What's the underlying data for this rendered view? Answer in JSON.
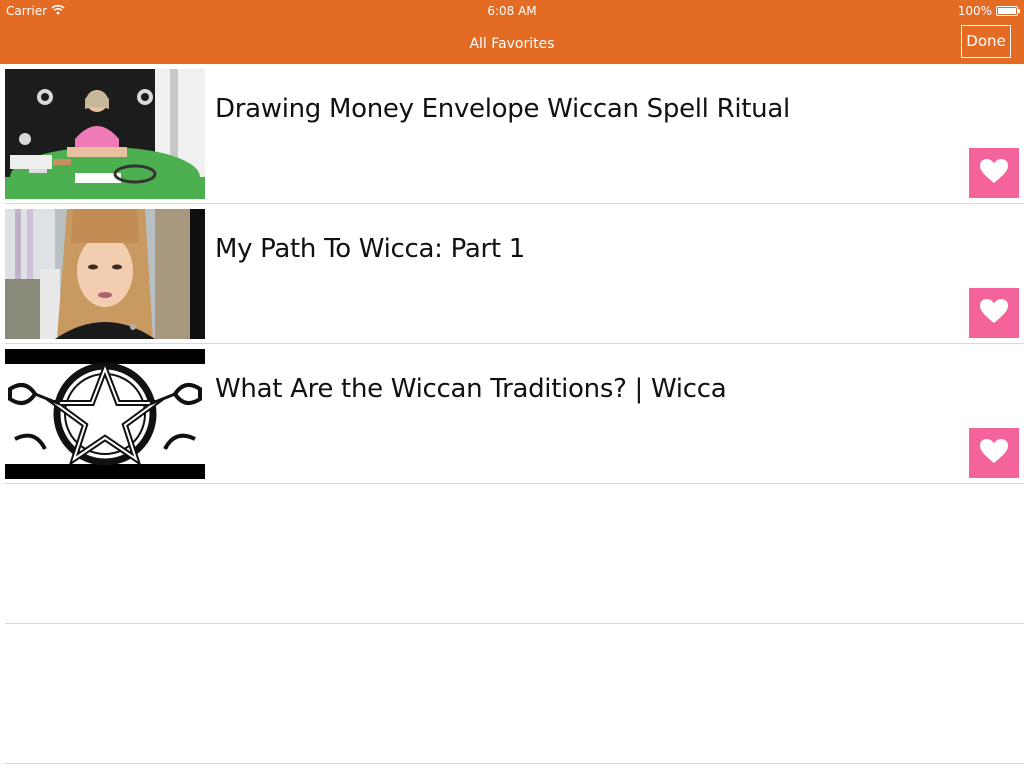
{
  "status_bar": {
    "carrier": "Carrier",
    "time": "6:08 AM",
    "battery": "100%"
  },
  "nav": {
    "title": "All Favorites",
    "done_label": "Done"
  },
  "favorites": [
    {
      "title": "Drawing Money Envelope Wiccan Spell Ritual",
      "thumbnail": "woman-at-green-table"
    },
    {
      "title": "My Path To Wicca: Part 1",
      "thumbnail": "woman-webcam"
    },
    {
      "title": "What Are the Wiccan Traditions? | Wicca",
      "thumbnail": "pentacle"
    }
  ],
  "colors": {
    "header": "#e36b24",
    "heart_button": "#f5639b",
    "divider": "#d9d9d9"
  },
  "icons": {
    "wifi": "wifi-icon",
    "battery": "battery-icon",
    "favorite": "heart-icon"
  }
}
